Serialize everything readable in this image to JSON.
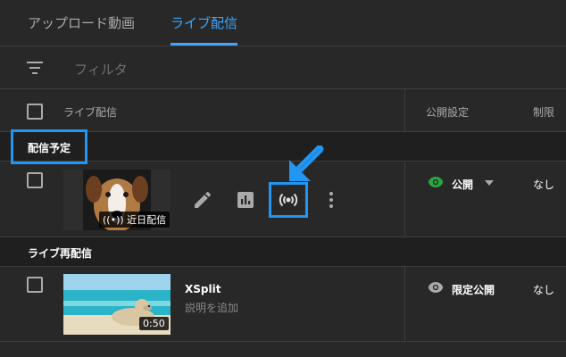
{
  "tabs": [
    {
      "label": "アップロード動画",
      "active": false
    },
    {
      "label": "ライブ配信",
      "active": true
    }
  ],
  "filter": {
    "placeholder": "フィルタ"
  },
  "columns": {
    "video": "ライブ配信",
    "visibility": "公開設定",
    "restrictions": "制限"
  },
  "sections": {
    "scheduled": "配信予定",
    "replays": "ライブ再配信"
  },
  "rows": [
    {
      "badge": "近日配信",
      "visibility": "公開",
      "restrictions": "なし"
    },
    {
      "title": "XSplit",
      "subtitle": "説明を追加",
      "duration": "0:50",
      "visibility": "限定公開",
      "restrictions": "なし"
    }
  ],
  "colors": {
    "accent": "#3ea6ff",
    "callout": "#2196f3",
    "public_eye": "#2ba640"
  }
}
